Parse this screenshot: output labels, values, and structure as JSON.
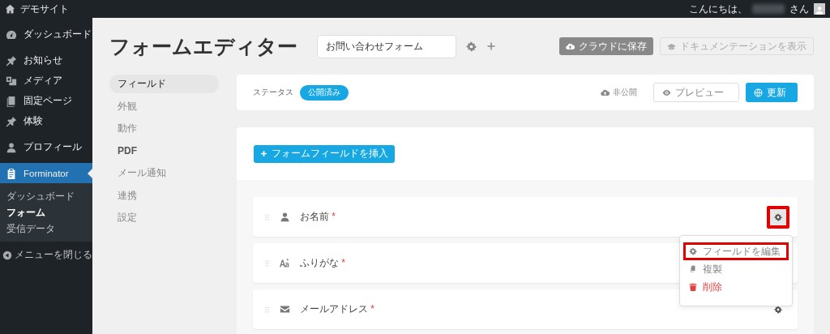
{
  "topbar": {
    "site_name": "デモサイト",
    "greeting": "こんにちは、",
    "honorific": "さん"
  },
  "sidebar": {
    "items": [
      {
        "label": "ダッシュボード",
        "selected": false
      },
      {
        "label": "お知らせ",
        "selected": false
      },
      {
        "label": "メディア",
        "selected": false
      },
      {
        "label": "固定ページ",
        "selected": false
      },
      {
        "label": "体験",
        "selected": false
      },
      {
        "label": "プロフィール",
        "selected": false
      },
      {
        "label": "Forminator",
        "selected": true,
        "children": [
          {
            "label": "ダッシュボード",
            "selected": false
          },
          {
            "label": "フォーム",
            "selected": true
          },
          {
            "label": "受信データ",
            "selected": false
          }
        ]
      }
    ],
    "collapse_label": "メニューを閉じる"
  },
  "editor": {
    "title": "フォームエディター",
    "form_name": "お問い合わせフォーム",
    "save_cloud": "クラウドに保存",
    "docs": "ドキュメンテーションを表示",
    "nav": [
      {
        "label": "フィールド",
        "selected": true
      },
      {
        "label": "外観",
        "selected": false
      },
      {
        "label": "動作",
        "selected": false
      },
      {
        "label": "PDF",
        "selected": false
      },
      {
        "label": "メール通知",
        "selected": false
      },
      {
        "label": "連携",
        "selected": false
      },
      {
        "label": "設定",
        "selected": false
      }
    ],
    "status": {
      "label": "ステータス",
      "badge": "公開済み",
      "unpublish": "非公開",
      "preview": "プレビュー",
      "update": "更新"
    },
    "insert_button": "フォームフィールドを挿入",
    "fields": [
      {
        "label": "お名前",
        "mark": "*",
        "settings_button": {
          "active": true,
          "highlighted": true
        },
        "menu": [
          {
            "label": "フィールドを編集",
            "kind": "normal",
            "highlighted": true
          },
          {
            "label": "複製",
            "kind": "normal",
            "highlighted": false
          },
          {
            "label": "削除",
            "kind": "danger",
            "highlighted": false
          }
        ]
      },
      {
        "label": "ふりがな",
        "mark": "*"
      },
      {
        "label": "メールアドレス",
        "mark": "*",
        "settings_button": {
          "active": false,
          "highlighted": false
        }
      }
    ]
  }
}
